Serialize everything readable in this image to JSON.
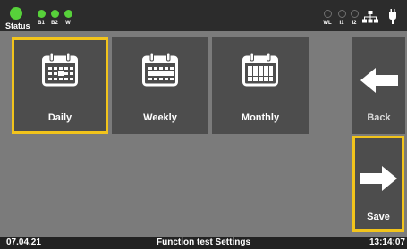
{
  "status_bar": {
    "status_label": "Status",
    "indicators_left": [
      {
        "label": "B1",
        "state": "on"
      },
      {
        "label": "B2",
        "state": "on"
      },
      {
        "label": "W",
        "state": "on"
      }
    ],
    "indicators_right": [
      {
        "label": "WL",
        "state": "off"
      },
      {
        "label": "I1",
        "state": "off"
      },
      {
        "label": "I2",
        "state": "off"
      }
    ],
    "icons": [
      "network-icon",
      "plug-icon"
    ]
  },
  "tiles": [
    {
      "label": "Daily",
      "icon": "calendar-day-icon",
      "selected": true
    },
    {
      "label": "Weekly",
      "icon": "calendar-week-icon",
      "selected": false
    },
    {
      "label": "Monthly",
      "icon": "calendar-month-icon",
      "selected": false
    }
  ],
  "actions": {
    "back_label": "Back",
    "save_label": "Save"
  },
  "footer": {
    "date": "07.04.21",
    "title": "Function test Settings",
    "time": "13:14:07"
  },
  "colors": {
    "background": "#7b7b7b",
    "tile": "#4d4d4d",
    "selection": "#f2c41c",
    "led_on": "#57d13a",
    "bar": "#2c2c2c"
  }
}
